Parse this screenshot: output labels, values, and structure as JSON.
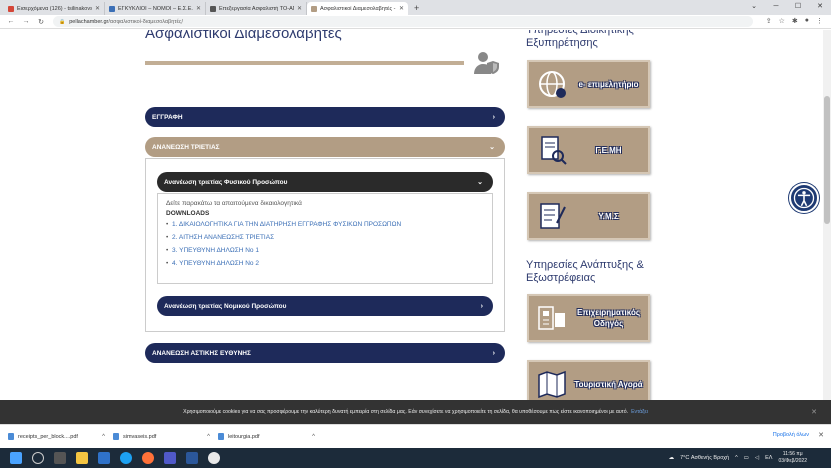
{
  "browser": {
    "tabs": [
      {
        "title": "Εισερχόμενα (126) - tsilinakovsa...",
        "color": "#d44638"
      },
      {
        "title": "ΕΓΚΥΚΛΙΟΙ – ΝΟΜΟΙ – Ε.Σ.Ε.Ε.",
        "color": "#3b6fb6"
      },
      {
        "title": "Επεξεργασία Ασφαλιστή ΤΟ-ΑΠΟ...",
        "color": "#555555"
      },
      {
        "title": "Ασφαλιστικοί Διαμεσολαβητές - ...",
        "color": "#b29d84"
      }
    ],
    "new_tab": "+",
    "url_host": "pellachamber.gr",
    "url_path": "/ασφαλιστικοί-διαμεσολαβητές/"
  },
  "page": {
    "title": "Ασφαλιστικοί Διαμεσολαβητές",
    "accordions": {
      "eggrafi": "ΕΓΓΡΑΦΗ",
      "ananeosi": "ΑΝΑΝΕΩΣΗ ΤΡΙΕΤΙΑΣ",
      "fysiko": "Ανανέωση τριετίας Φυσικού Προσώπου",
      "nomiko": "Ανανέωση τριετίας Νομικού Προσώπου",
      "astiki": "ΑΝΑΝΕΩΣΗ ΑΣΤΙΚΗΣ ΕΥΘΥΝΗΣ"
    },
    "lead": "Δείτε παρακάτω τα απαιτούμενα δικαιολογητικά",
    "downloads_label": "DOWNLOADS",
    "links": [
      "1. ΔΙΚΑΙΟΛΟΓΗΤΙΚΑ ΓΙΑ ΤΗΝ ΔΙΑΤΗΡΗΣΗ ΕΓΓΡΑΦΗΣ ΦΥΣΙΚΩΝ ΠΡΟΣΩΠΩΝ",
      "2. ΑΙΤΗΣΗ ΑΝΑΝΕΩΣΗΣ ΤΡΙΕΤΙΑΣ",
      "3. ΥΠΕΥΘΥΝΗ ΔΗΛΩΣΗ Νο 1",
      "4. ΥΠΕΥΘΥΝΗ ΔΗΛΩΣΗ Νο 2"
    ]
  },
  "sidebar": {
    "heading1": "Υπηρεσίες Διοικητικής Εξυπηρέτησης",
    "heading2": "Υπηρεσίες Ανάπτυξης & Εξωστρέφειας",
    "cards": {
      "e_epim": "e- επιμελητήριο",
      "gemi": "Γ.Ε.ΜΗ",
      "yms": "Υ.Μ.Σ",
      "odigos": "Επιχειρηματικός Οδηγός",
      "agora": "Τουριστική Αγορά"
    }
  },
  "cookie": {
    "text": "Χρησιμοποιούμε cookies για να σας προσφέρουμε την καλύτερη δυνατή εμπειρία στη σελίδα μας. Εάν συνεχίσετε να χρησιμοποιείτε τη σελίδα, θα υποθέσουμε πως είστε ικανοποιημένοι με αυτό.",
    "link": "Εντάξει"
  },
  "downloads_bar": {
    "files": [
      "receipts_per_block....pdf",
      "simvaseis.pdf",
      "leitourgia.pdf"
    ],
    "show_all": "Προβολή όλων"
  },
  "taskbar": {
    "weather": "7°C Ασθενής Βροχή",
    "lang": "ΕΛ",
    "time": "11:56 πμ",
    "date": "03/Φεβ/2022"
  },
  "colors": {
    "navy": "#1e2a5a",
    "tan": "#b29d84",
    "title": "#2d3a6e"
  }
}
